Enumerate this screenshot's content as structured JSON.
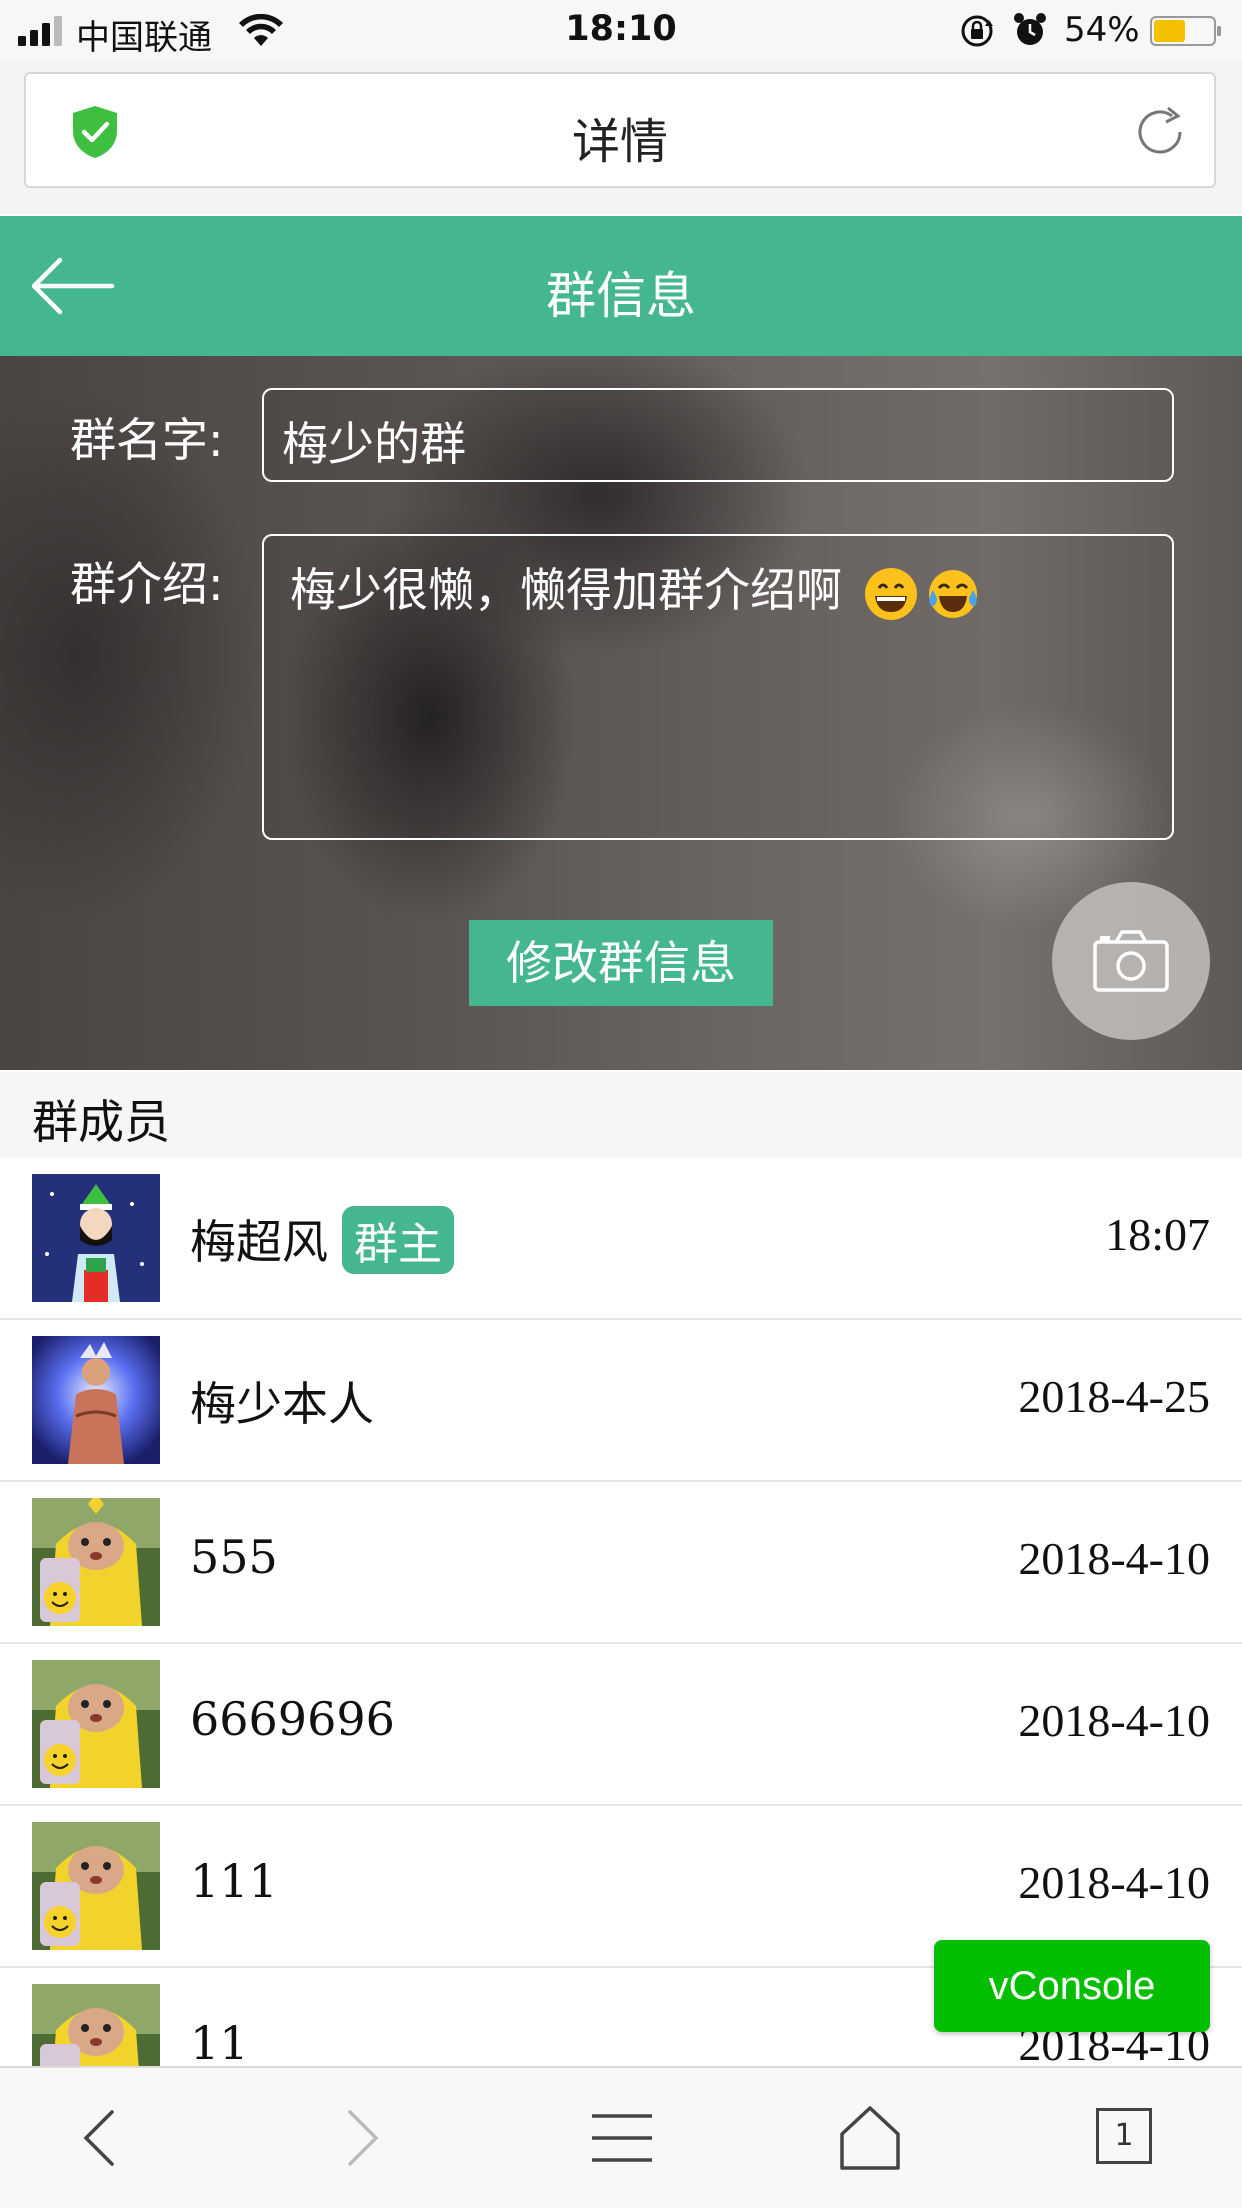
{
  "status_bar": {
    "carrier": "中国联通",
    "time": "18:10",
    "battery_percent": "54%",
    "battery_level": 0.54,
    "icons": [
      "signal-icon",
      "wifi-icon",
      "rotation-lock-icon",
      "alarm-icon",
      "battery-icon"
    ]
  },
  "browser": {
    "page_title": "详情",
    "icons": [
      "shield-check-icon",
      "refresh-icon"
    ]
  },
  "header": {
    "title": "群信息",
    "back_icon": "arrow-left-icon"
  },
  "form": {
    "name_label": "群名字:",
    "name_value": "梅少的群",
    "intro_label": "群介绍:",
    "intro_value": "梅少很懒，懒得加群介绍啊",
    "intro_emojis": [
      "grinning-face",
      "face-with-tears-of-joy"
    ],
    "submit_label": "修改群信息",
    "camera_icon": "camera-icon"
  },
  "members": {
    "section_title": "群成员",
    "owner_badge": "群主",
    "items": [
      {
        "name": "梅超风",
        "is_owner": true,
        "time": "18:07"
      },
      {
        "name": "梅少本人",
        "is_owner": false,
        "time": "2018-4-25"
      },
      {
        "name": "555",
        "is_owner": false,
        "time": "2018-4-10"
      },
      {
        "name": "6669696",
        "is_owner": false,
        "time": "2018-4-10"
      },
      {
        "name": "111",
        "is_owner": false,
        "time": "2018-4-10"
      },
      {
        "name": "11",
        "is_owner": false,
        "time": "2018-4-10"
      }
    ]
  },
  "vconsole": {
    "label": "vConsole",
    "color": "#04be02"
  },
  "toolbar": {
    "tab_count": "1",
    "icons": [
      "back-icon",
      "forward-icon",
      "menu-icon",
      "home-icon",
      "tabs-icon"
    ]
  },
  "colors": {
    "accent": "#45b790"
  }
}
